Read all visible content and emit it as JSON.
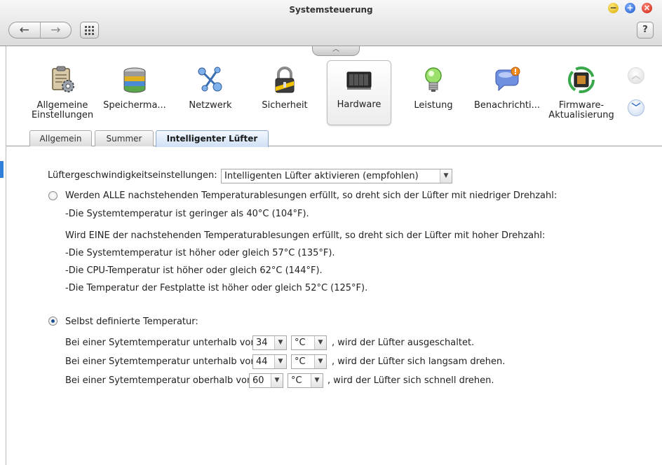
{
  "window": {
    "title": "Systemsteuerung",
    "help_label": "?"
  },
  "categories": [
    {
      "label": "Allgemeine\nEinstellungen",
      "icon": "clipboard-gear-icon"
    },
    {
      "label": "Speicherma...",
      "icon": "storage-disks-icon"
    },
    {
      "label": "Netzwerk",
      "icon": "network-icon"
    },
    {
      "label": "Sicherheit",
      "icon": "padlock-icon"
    },
    {
      "label": "Hardware",
      "icon": "hardware-nas-icon"
    },
    {
      "label": "Leistung",
      "icon": "lightbulb-icon"
    },
    {
      "label": "Benachrichti...",
      "icon": "notification-bubble-icon"
    },
    {
      "label": "Firmware-\nAktualisierung",
      "icon": "firmware-chip-icon"
    }
  ],
  "tabs": [
    {
      "label": "Allgemein"
    },
    {
      "label": "Summer"
    },
    {
      "label": "Intelligenter Lüfter"
    }
  ],
  "fan": {
    "speed_label": "Lüftergeschwindigkeitseinstellungen:",
    "speed_value": "Intelligenten Lüfter aktivieren (empfohlen)",
    "auto_option": "Werden ALLE nachstehenden Temperaturablesungen erfüllt, so dreht sich der Lüfter mit niedriger Drehzahl:",
    "low_conditions": [
      "-Die Systemtemperatur ist geringer als 40°C (104°F)."
    ],
    "high_intro": "Wird EINE der nachstehenden Temperaturablesungen erfüllt, so dreht sich der Lüfter mit hoher Drehzahl:",
    "high_conditions": [
      "-Die Systemtemperatur ist höher oder gleich 57°C (135°F).",
      "-Die CPU-Temperatur ist höher oder gleich 62°C (144°F).",
      "-Die Temperatur der Festplatte ist höher oder gleich 52°C (125°F)."
    ],
    "custom_option": "Selbst definierte Temperatur:",
    "custom_rows": [
      {
        "prefix": "Bei einer Sytemtemperatur unterhalb von",
        "value": "34",
        "unit": "°C",
        "suffix": ", wird der Lüfter ausgeschaltet."
      },
      {
        "prefix": "Bei einer Sytemtemperatur unterhalb von",
        "value": "44",
        "unit": "°C",
        "suffix": ", wird der Lüfter sich langsam drehen."
      },
      {
        "prefix": "Bei einer Sytemtemperatur oberhalb von",
        "value": "60",
        "unit": "°C",
        "suffix": ", wird der Lüfter sich schnell drehen."
      }
    ]
  }
}
